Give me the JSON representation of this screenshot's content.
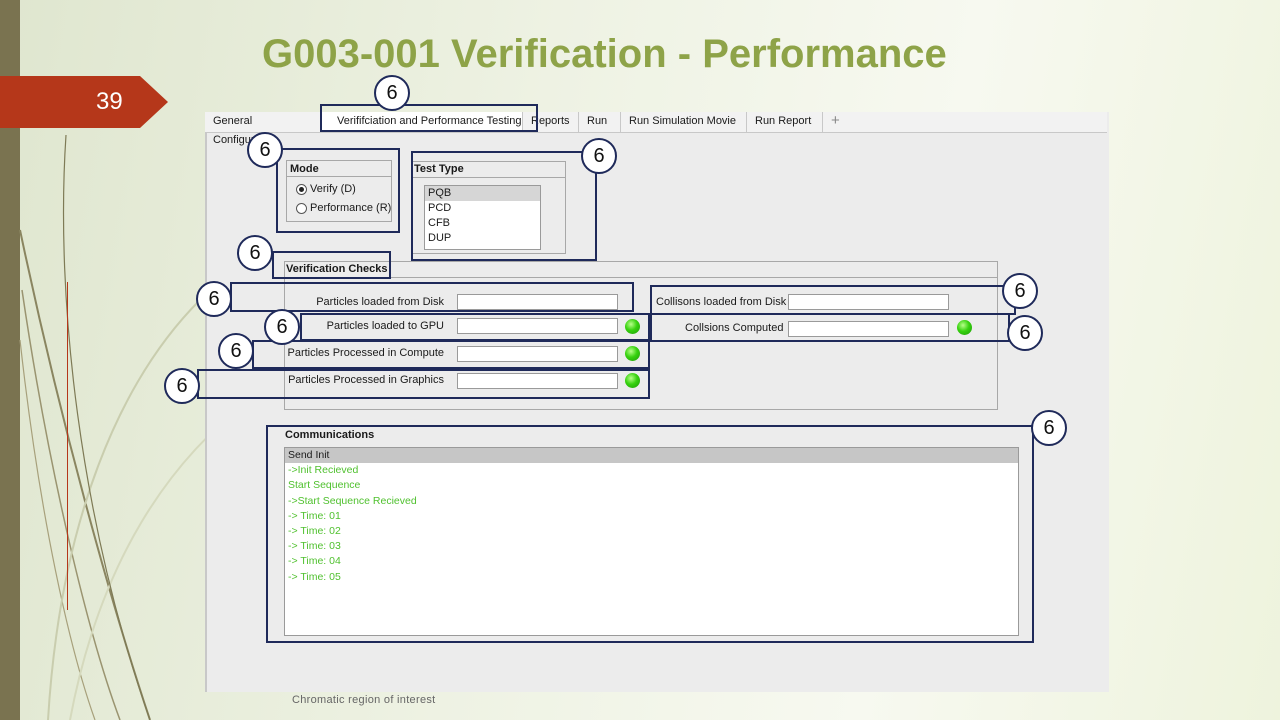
{
  "slide": {
    "number": "39",
    "title": "G003-001 Verification - Performance",
    "footer": "Chromatic region of interest"
  },
  "tabs": [
    {
      "label": "General Configuration"
    },
    {
      "label": "Verififciation and Performance Testing"
    },
    {
      "label": "Reports"
    },
    {
      "label": "Run"
    },
    {
      "label": "Run Simulation Movie"
    },
    {
      "label": "Run Report"
    },
    {
      "label": "+"
    }
  ],
  "mode": {
    "title": "Mode",
    "options": [
      {
        "label": "Verify (D)",
        "selected": true
      },
      {
        "label": "Performance (R)",
        "selected": false
      }
    ]
  },
  "test_type": {
    "title": "Test Type",
    "items": [
      "PQB",
      "PCD",
      "CFB",
      "DUP"
    ],
    "selected": "PQB"
  },
  "verification": {
    "title": "Verification Checks",
    "left": [
      {
        "label": "Particles loaded from Disk",
        "value": "",
        "led": false
      },
      {
        "label": "Particles loaded to GPU",
        "value": "",
        "led": true
      },
      {
        "label": "Particles Processed  in Compute",
        "value": "",
        "led": true
      },
      {
        "label": "Particles Processed in Graphics",
        "value": "",
        "led": true
      }
    ],
    "right": [
      {
        "label": "Collisons loaded from Disk",
        "value": "",
        "led": false
      },
      {
        "label": "Collsions Computed",
        "value": "",
        "led": true
      }
    ]
  },
  "communications": {
    "title": "Communications",
    "lines": [
      "Send Init",
      "->Init Recieved",
      "Start Sequence",
      "->Start Sequence Recieved",
      "-> Time: 01",
      "-> Time: 02",
      "-> Time: 03",
      "-> Time: 04",
      "-> Time: 05"
    ]
  },
  "annotation_label": "6",
  "colors": {
    "title": "#8ea348",
    "accent": "#b5371a",
    "annotation": "#1f2a5a",
    "log_text": "#50c12f",
    "led": "#37d20f"
  }
}
